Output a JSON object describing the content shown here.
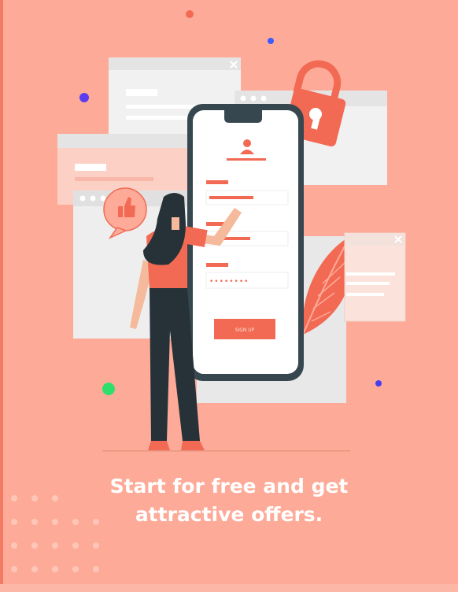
{
  "screen": {
    "background_color": "#fdab98",
    "accent_color": "#f26a54",
    "phone_frame_color": "#37474f"
  },
  "illustration": {
    "signup_button_label": "SIGN UP",
    "password_mask": "••••••••",
    "icons": [
      "lock-icon",
      "user-icon",
      "thumbs-up-icon",
      "leaf-icon",
      "close-icon"
    ]
  },
  "headline": {
    "line1": "Start for free and get",
    "line2": "attractive offers."
  }
}
